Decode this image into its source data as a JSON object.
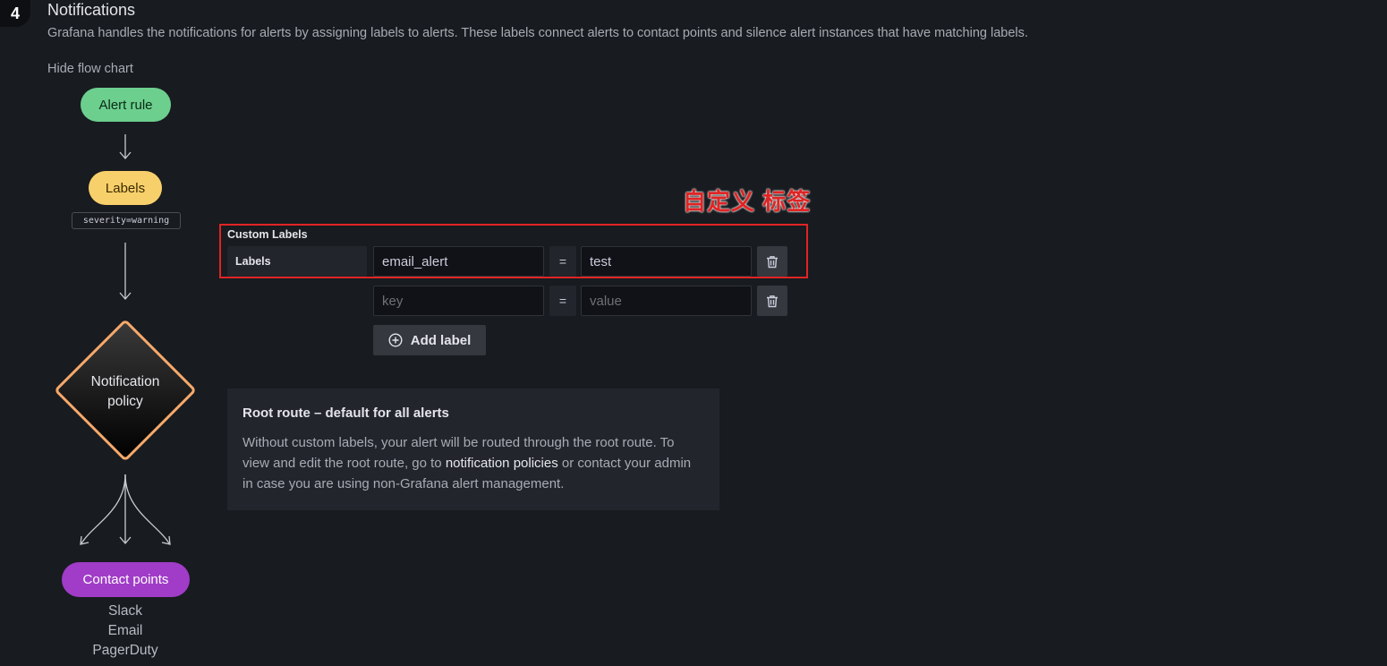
{
  "section": {
    "step": "4",
    "title": "Notifications",
    "description": "Grafana handles the notifications for alerts by assigning labels to alerts. These labels connect alerts to contact points and silence alert instances that have matching labels.",
    "hide_flow_chart": "Hide flow chart"
  },
  "flow": {
    "alert_rule": "Alert rule",
    "labels": "Labels",
    "label_example": "severity=warning",
    "policy_line1": "Notification",
    "policy_line2": "policy",
    "contact_points": "Contact points",
    "contact_types": [
      "Slack",
      "Email",
      "PagerDuty"
    ]
  },
  "annotation": "自定义 标签",
  "custom_labels": {
    "title": "Custom Labels",
    "row_label": "Labels",
    "rows": [
      {
        "key": "email_alert",
        "value": "test"
      },
      {
        "key": "",
        "value": ""
      }
    ],
    "key_placeholder": "key",
    "value_placeholder": "value",
    "operator": "=",
    "add_label": "Add label"
  },
  "info": {
    "title": "Root route – default for all alerts",
    "body_before": "Without custom labels, your alert will be routed through the root route. To view and edit the root route, go to ",
    "link": "notification policies",
    "body_after": " or contact your admin in case you are using non-Grafana alert management."
  },
  "colors": {
    "alert_rule": "#6ccf8e",
    "labels": "#f8d06b",
    "contact_points": "#a03cc7",
    "diamond_border": "#f5a96b",
    "annotation_red": "#e02424"
  }
}
